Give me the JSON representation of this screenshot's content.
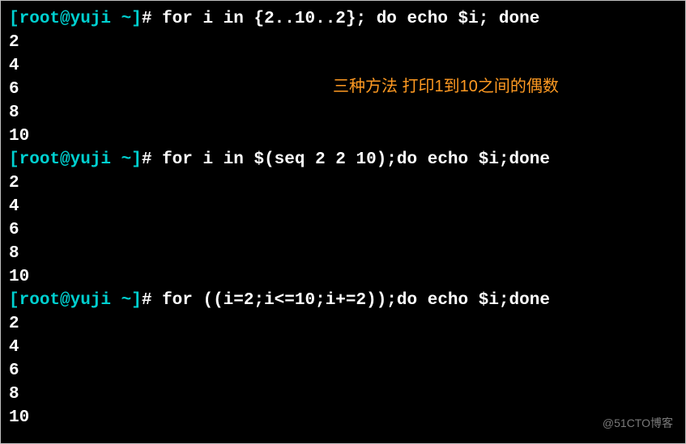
{
  "prompt": {
    "open_bracket": "[",
    "user_host_path": "root@yuji ~",
    "close_bracket": "]",
    "hash": "# "
  },
  "blocks": [
    {
      "command": "for i in {2..10..2}; do echo $i; done",
      "output": [
        "2",
        "4",
        "6",
        "8",
        "10"
      ]
    },
    {
      "command": "for i in $(seq 2 2 10);do echo $i;done",
      "output": [
        "2",
        "4",
        "6",
        "8",
        "10"
      ]
    },
    {
      "command": "for ((i=2;i<=10;i+=2));do echo $i;done",
      "output": [
        "2",
        "4",
        "6",
        "8",
        "10"
      ]
    }
  ],
  "annotation": "三种方法 打印1到10之间的偶数",
  "watermark": "@51CTO博客"
}
